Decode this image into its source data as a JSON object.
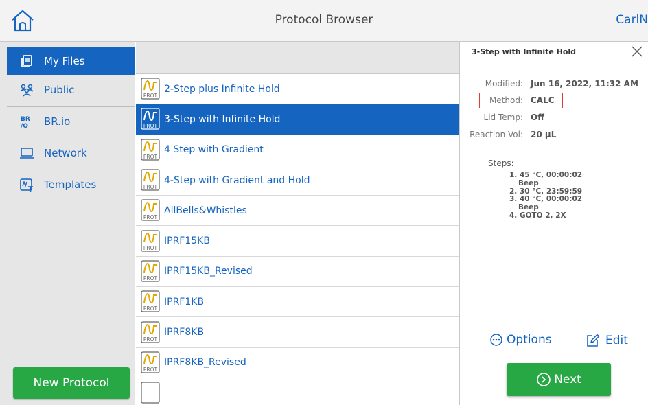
{
  "header": {
    "title": "Protocol Browser",
    "user": "CarlN"
  },
  "sidebar": {
    "items": [
      {
        "label": "My Files",
        "icon": "my-files-icon",
        "active": true
      },
      {
        "label": "Public",
        "icon": "public-users-icon",
        "active": false
      },
      {
        "label": "BR.io",
        "icon": "brio-logo-icon",
        "active": false
      },
      {
        "label": "Network",
        "icon": "network-monitor-icon",
        "active": false
      },
      {
        "label": "Templates",
        "icon": "templates-icon",
        "active": false
      }
    ],
    "new_protocol": "New Protocol"
  },
  "file_list": {
    "icon_label": "PROT",
    "items": [
      {
        "name": "2-Step plus Infinite Hold",
        "selected": false
      },
      {
        "name": "3-Step with Infinite Hold",
        "selected": true
      },
      {
        "name": "4 Step with Gradient",
        "selected": false
      },
      {
        "name": "4-Step with Gradient and Hold",
        "selected": false
      },
      {
        "name": "AllBells&Whistles",
        "selected": false
      },
      {
        "name": "IPRF15KB",
        "selected": false
      },
      {
        "name": "IPRF15KB_Revised",
        "selected": false
      },
      {
        "name": "IPRF1KB",
        "selected": false
      },
      {
        "name": "IPRF8KB",
        "selected": false
      },
      {
        "name": "IPRF8KB_Revised",
        "selected": false
      }
    ]
  },
  "detail": {
    "title": "3-Step with Infinite Hold",
    "modified_label": "Modified:",
    "modified_value": "Jun 16, 2022, 11:32 AM",
    "method_label": "Method:",
    "method_value": "CALC",
    "lid_label": "Lid Temp:",
    "lid_value": "Off",
    "vol_label": "Reaction Vol:",
    "vol_value": "20 µL",
    "steps_label": "Steps:",
    "steps": [
      {
        "text": "1. 45 °C, 00:00:02",
        "sub": false
      },
      {
        "text": "Beep",
        "sub": true
      },
      {
        "text": "2. 30 °C, 23:59:59",
        "sub": false
      },
      {
        "text": "3. 40 °C, 00:00:02",
        "sub": false
      },
      {
        "text": "Beep",
        "sub": true
      },
      {
        "text": "4. GOTO 2, 2X",
        "sub": false
      }
    ],
    "options_label": "Options",
    "edit_label": "Edit",
    "next_label": "Next"
  },
  "colors": {
    "accent": "#1565c0",
    "green": "#28a745",
    "highlight": "#e53935"
  }
}
